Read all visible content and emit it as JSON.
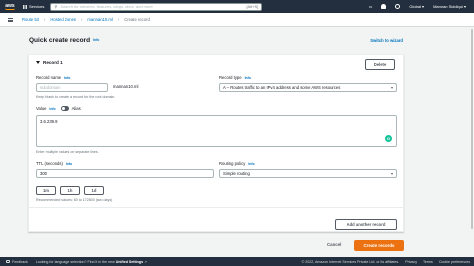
{
  "topnav": {
    "logo_text": "aws",
    "services_label": "Services",
    "search_placeholder": "Search for services, features, blogs, docs, and more",
    "search_shortcut": "[Alt+S]",
    "region": "Global",
    "user": "Mannan Siddiqui"
  },
  "breadcrumb": {
    "items": [
      "Route 53",
      "Hosted zones",
      "mannan10.ml"
    ],
    "current": "Create record"
  },
  "page": {
    "title": "Quick create record",
    "info": "Info",
    "switch_label": "Switch to wizard"
  },
  "record": {
    "heading": "Record 1",
    "delete_label": "Delete",
    "name_label": "Record name",
    "name_info": "Info",
    "name_placeholder": "subdomain",
    "name_suffix": "mannan10.ml",
    "name_hint": "Keep blank to create a record for the root domain.",
    "type_label": "Record type",
    "type_info": "Info",
    "type_value": "A – Routes traffic to an IPv4 address and some AWS resources",
    "value_label": "Value",
    "value_info": "Info",
    "alias_label": "Alias",
    "value_text": "3.6.239.9",
    "value_hint": "Enter multiple values on separate lines.",
    "ttl_label": "TTL (seconds)",
    "ttl_info": "Info",
    "ttl_value": "300",
    "ttl_buttons": [
      "1m",
      "1h",
      "1d"
    ],
    "ttl_hint": "Recommended values: 60 to 172800 (two days)",
    "policy_label": "Routing policy",
    "policy_info": "Info",
    "policy_value": "Simple routing",
    "grammarly": "G"
  },
  "actions": {
    "add_record": "Add another record",
    "cancel": "Cancel",
    "create": "Create records"
  },
  "footer": {
    "feedback": "Feedback",
    "lang_prefix": "Looking for language selection? Find it in the new",
    "lang_link": "Unified Settings",
    "copyright": "© 2022, Amazon Internet Services Private Ltd. or its affiliates.",
    "privacy": "Privacy",
    "terms": "Terms",
    "cookie": "Cookie preferences"
  }
}
